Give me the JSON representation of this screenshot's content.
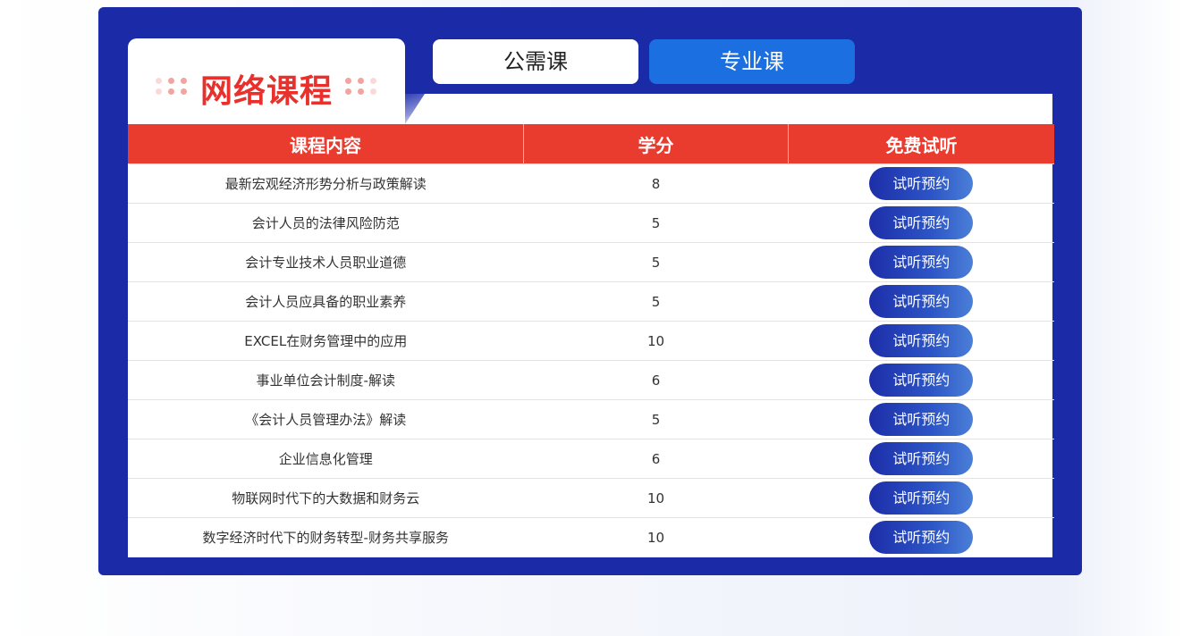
{
  "section": {
    "title": "网络课程"
  },
  "tabs": [
    {
      "label": "公需课",
      "active": false
    },
    {
      "label": "专业课",
      "active": true
    }
  ],
  "colors": {
    "panel": "#1b2aa6",
    "header": "#ea3b2f",
    "title": "#e8302c",
    "active_tab": "#1b6fe0"
  },
  "table": {
    "headers": [
      "课程内容",
      "学分",
      "免费试听"
    ],
    "rows": [
      {
        "course": "最新宏观经济形势分析与政策解读",
        "credit": "8",
        "action": "试听预约"
      },
      {
        "course": "会计人员的法律风险防范",
        "credit": "5",
        "action": "试听预约"
      },
      {
        "course": "会计专业技术人员职业道德",
        "credit": "5",
        "action": "试听预约"
      },
      {
        "course": "会计人员应具备的职业素养",
        "credit": "5",
        "action": "试听预约"
      },
      {
        "course": "EXCEL在财务管理中的应用",
        "credit": "10",
        "action": "试听预约"
      },
      {
        "course": "事业单位会计制度-解读",
        "credit": "6",
        "action": "试听预约"
      },
      {
        "course": "《会计人员管理办法》解读",
        "credit": "5",
        "action": "试听预约"
      },
      {
        "course": "企业信息化管理",
        "credit": "6",
        "action": "试听预约"
      },
      {
        "course": "物联网时代下的大数据和财务云",
        "credit": "10",
        "action": "试听预约"
      },
      {
        "course": "数字经济时代下的财务转型-财务共享服务",
        "credit": "10",
        "action": "试听预约"
      }
    ]
  }
}
